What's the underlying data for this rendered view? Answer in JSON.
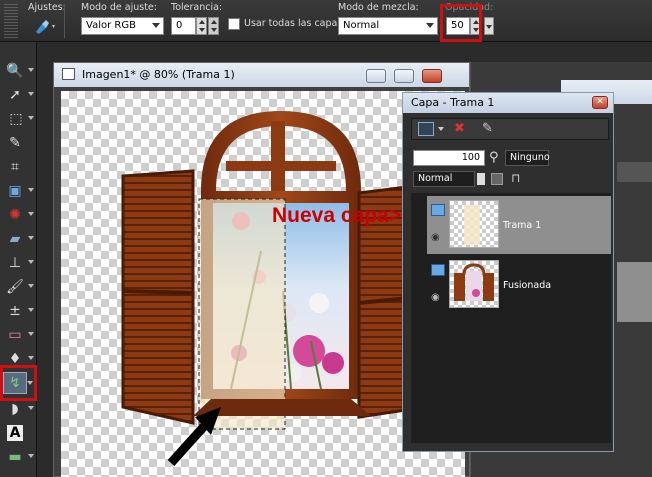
{
  "options": {
    "ajustes_label": "Ajustes:",
    "modo_ajuste_label": "Modo de ajuste:",
    "modo_ajuste_value": "Valor RGB",
    "tolerancia_label": "Tolerancia:",
    "tolerancia_value": "0",
    "usar_todas_label": "Usar todas las capas",
    "modo_mezcla_label": "Modo de mezcla:",
    "modo_mezcla_value": "Normal",
    "opacidad_label": "Opacidad:",
    "opacidad_value": "50"
  },
  "image_window": {
    "title": "Imagen1* @  80% (Trama 1)"
  },
  "layers_panel": {
    "title": "Capa - Trama 1",
    "opacity_value": "100",
    "mask_label": "Ninguno",
    "blend_value": "Normal",
    "layers": [
      {
        "name": "Trama 1",
        "active": true
      },
      {
        "name": "Fusionada",
        "active": false
      }
    ]
  },
  "annotation": {
    "text": "Nueva capa>"
  },
  "colors": {
    "highlight_red": "#d01010",
    "annotation_red": "#cc0000",
    "wood": "#8b3a12"
  }
}
